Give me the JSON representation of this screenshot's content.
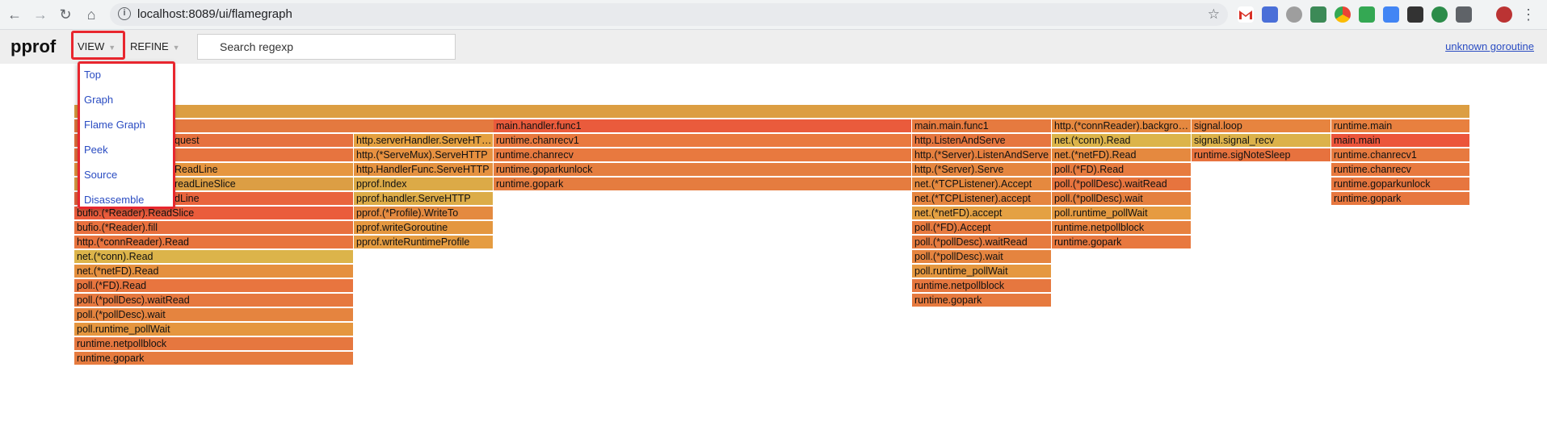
{
  "browser": {
    "url": "localhost:8089/ui/flamegraph",
    "back_icon": "←",
    "forward_icon": "→",
    "reload_icon": "↻",
    "home_icon": "⌂",
    "info_icon": "i",
    "star_icon": "☆"
  },
  "app": {
    "brand": "pprof",
    "view_label": "VIEW",
    "refine_label": "REFINE",
    "caret": "▼",
    "search_placeholder": "Search regexp",
    "goroutine_link": "unknown goroutine"
  },
  "view_menu": [
    "Top",
    "Graph",
    "Flame Graph",
    "Peek",
    "Source",
    "Disassemble"
  ],
  "flame_frames": [
    {
      "label": "",
      "color": "#dc9e42"
    },
    {
      "label": "",
      "color": "#e4793f"
    },
    {
      "label": "main.handler.func1",
      "color": "#ea5b3c"
    },
    {
      "label": "main.main.func1",
      "color": "#e67a3f"
    },
    {
      "label": "http.(*connReader).backgroundRead",
      "color": "#e5883f"
    },
    {
      "label": "signal.loop",
      "color": "#e7843f"
    },
    {
      "label": "runtime.main",
      "color": "#e8803f"
    },
    {
      "label": "quest",
      "color": "#e6713e"
    },
    {
      "label": "http.serverHandler.ServeHTTP",
      "color": "#e5a140"
    },
    {
      "label": "runtime.chanrecv1",
      "color": "#e9793f"
    },
    {
      "label": "http.ListenAndServe",
      "color": "#e6763f"
    },
    {
      "label": "net.(*conn).Read",
      "color": "#dcb44a"
    },
    {
      "label": "signal.signal_recv",
      "color": "#dcb24a"
    },
    {
      "label": "main.main",
      "color": "#ec553b"
    },
    {
      "label": "",
      "color": "#e7743f"
    },
    {
      "label": "http.(*ServeMux).ServeHTTP",
      "color": "#e79140"
    },
    {
      "label": "runtime.chanrecv",
      "color": "#e8793f"
    },
    {
      "label": "http.(*Server).ListenAndServe",
      "color": "#e6803f"
    },
    {
      "label": "net.(*netFD).Read",
      "color": "#e5893f"
    },
    {
      "label": "runtime.sigNoteSleep",
      "color": "#e7723e"
    },
    {
      "label": "runtime.chanrecv1",
      "color": "#e77a3f"
    },
    {
      "label": "ReadLine",
      "color": "#e69640"
    },
    {
      "label": "http.HandlerFunc.ServeHTTP",
      "color": "#e59240"
    },
    {
      "label": "runtime.goparkunlock",
      "color": "#e57e3f"
    },
    {
      "label": "http.(*Server).Serve",
      "color": "#e5863f"
    },
    {
      "label": "poll.(*FD).Read",
      "color": "#e77b3f"
    },
    {
      "label": "runtime.chanrecv",
      "color": "#e8793f"
    },
    {
      "label": "readLineSlice",
      "color": "#dc9e44"
    },
    {
      "label": "pprof.Index",
      "color": "#dcaa47"
    },
    {
      "label": "runtime.gopark",
      "color": "#e57c3f"
    },
    {
      "label": "net.(*TCPListener).Accept",
      "color": "#e5893f"
    },
    {
      "label": "poll.(*pollDesc).waitRead",
      "color": "#e7743e"
    },
    {
      "label": "runtime.goparkunlock",
      "color": "#e7763f"
    },
    {
      "label": "dLine",
      "color": "#e9643d"
    },
    {
      "label": "pprof.handler.ServeHTTP",
      "color": "#dcac48"
    },
    {
      "label": "net.(*TCPListener).accept",
      "color": "#e5853f"
    },
    {
      "label": "poll.(*pollDesc).wait",
      "color": "#e5803f"
    },
    {
      "label": "runtime.gopark",
      "color": "#e7773f"
    },
    {
      "label": "bufio.(*Reader).ReadSlice",
      "color": "#ea5c3c"
    },
    {
      "label": "pprof.(*Profile).WriteTo",
      "color": "#e48a40"
    },
    {
      "label": "net.(*netFD).accept",
      "color": "#e4a143"
    },
    {
      "label": "poll.runtime_pollWait",
      "color": "#e69b41"
    },
    {
      "label": "bufio.(*Reader).fill",
      "color": "#e8703e"
    },
    {
      "label": "pprof.writeGoroutine",
      "color": "#e4973f"
    },
    {
      "label": "poll.(*FD).Accept",
      "color": "#e77a3f"
    },
    {
      "label": "runtime.netpollblock",
      "color": "#e7813f"
    },
    {
      "label": "http.(*connReader).Read",
      "color": "#e8743e"
    },
    {
      "label": "pprof.writeRuntimeProfile",
      "color": "#e59c41"
    },
    {
      "label": "poll.(*pollDesc).waitRead",
      "color": "#e67b3f"
    },
    {
      "label": "runtime.gopark",
      "color": "#e8783f"
    },
    {
      "label": "net.(*conn).Read",
      "color": "#dcb44a"
    },
    {
      "label": "poll.(*pollDesc).wait",
      "color": "#e5843f"
    },
    {
      "label": "net.(*netFD).Read",
      "color": "#e5903f"
    },
    {
      "label": "poll.runtime_pollWait",
      "color": "#e59840"
    },
    {
      "label": "poll.(*FD).Read",
      "color": "#e8753f"
    },
    {
      "label": "runtime.netpollblock",
      "color": "#e6773f"
    },
    {
      "label": "poll.(*pollDesc).waitRead",
      "color": "#e6783f"
    },
    {
      "label": "runtime.gopark",
      "color": "#e67a3f"
    },
    {
      "label": "poll.(*pollDesc).wait",
      "color": "#e5843f"
    },
    {
      "label": "poll.runtime_pollWait",
      "color": "#e5963f"
    },
    {
      "label": "runtime.netpollblock",
      "color": "#e6773f"
    },
    {
      "label": "runtime.gopark",
      "color": "#e67b3f"
    }
  ]
}
